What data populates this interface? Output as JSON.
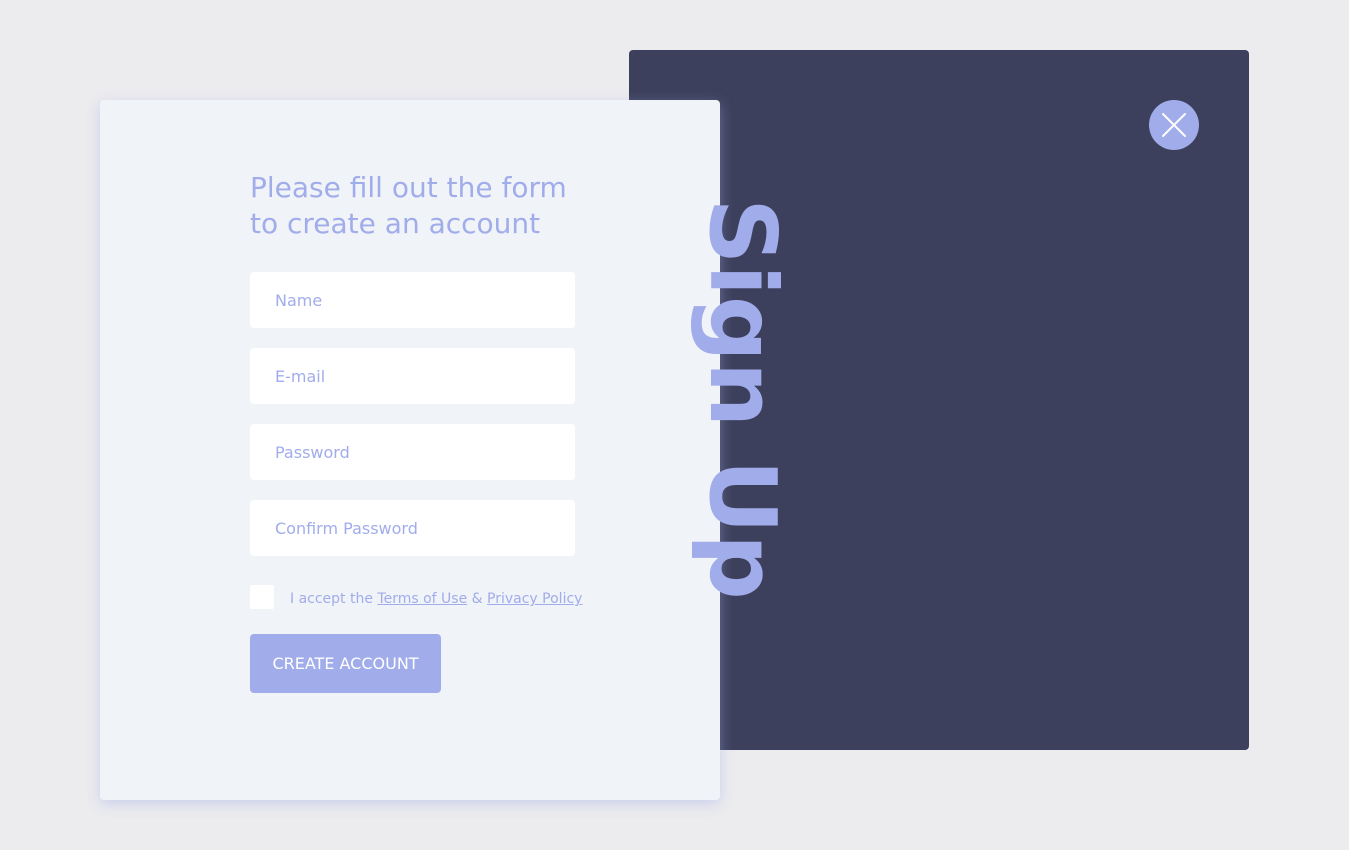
{
  "panel": {
    "title": "Sign Up",
    "close_icon": "close-icon"
  },
  "form": {
    "heading": "Please fill out the form to create an account",
    "fields": [
      {
        "placeholder": "Name",
        "value": ""
      },
      {
        "placeholder": "E-mail",
        "value": ""
      },
      {
        "placeholder": "Password",
        "value": ""
      },
      {
        "placeholder": "Confirm Password",
        "value": ""
      }
    ],
    "terms": {
      "checked": false,
      "prefix": "I accept the",
      "terms_link": "Terms of Use",
      "separator": "&",
      "privacy_link": "Privacy Policy"
    },
    "submit_label": "CREATE ACCOUNT"
  },
  "colors": {
    "background": "#ececee",
    "dark_panel": "#3d405c",
    "accent": "#a1aceb",
    "card": "#f0f3f7",
    "input": "#ffffff"
  }
}
